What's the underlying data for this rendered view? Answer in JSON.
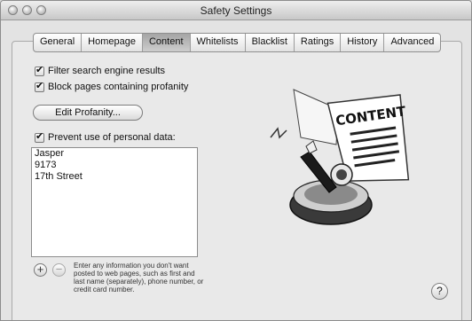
{
  "window": {
    "title": "Safety Settings"
  },
  "tabs": [
    {
      "label": "General"
    },
    {
      "label": "Homepage"
    },
    {
      "label": "Content",
      "selected": true
    },
    {
      "label": "Whitelists"
    },
    {
      "label": "Blacklist"
    },
    {
      "label": "Ratings"
    },
    {
      "label": "History"
    },
    {
      "label": "Advanced"
    }
  ],
  "options": {
    "filter_search": {
      "label": "Filter search engine results",
      "checked": true
    },
    "block_profanity": {
      "label": "Block pages containing profanity",
      "checked": true
    },
    "edit_profanity_button": "Edit Profanity...",
    "prevent_personal": {
      "label": "Prevent use of personal data:",
      "checked": true
    }
  },
  "personal_data": [
    "Jasper",
    "9173",
    "17th Street"
  ],
  "controls": {
    "add": "+",
    "remove": "−",
    "help": "?"
  },
  "hint": "Enter any information you don't want posted to web pages, such as first and last name (separately), phone number, or credit card number.",
  "illustration": {
    "sign_text": "CONTENT",
    "icon": "content-filter-illustration"
  }
}
